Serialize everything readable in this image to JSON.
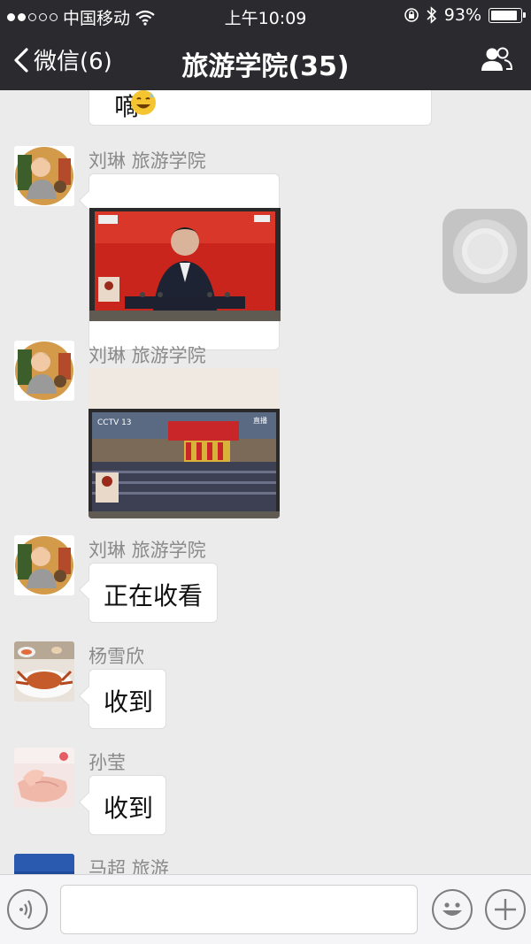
{
  "status_bar": {
    "carrier": "中国移动",
    "time": "上午10:09",
    "battery": "93%",
    "battery_level": 0.93
  },
  "nav": {
    "back_label": "微信(6)",
    "title": "旅游学院(35)"
  },
  "messages": [
    {
      "sender": "",
      "text": "嘀",
      "emoji": "grinning-sweat-emoji"
    },
    {
      "sender": "刘琳 旅游学院",
      "type": "image",
      "image": "tv-broadcast-speaker-photo"
    },
    {
      "sender": "刘琳 旅游学院",
      "type": "image",
      "image": "tv-broadcast-assembly-hall-photo",
      "tv_channel": "CCTV 13",
      "tv_live": "直播"
    },
    {
      "sender": "刘琳 旅游学院",
      "text": "正在收看"
    },
    {
      "sender": "杨雪欣",
      "text": "收到"
    },
    {
      "sender": "孙莹",
      "text": "收到"
    },
    {
      "sender": "马超 旅游",
      "text": ""
    }
  ],
  "input": {
    "placeholder": ""
  },
  "icons": {
    "back": "chevron-left-icon",
    "members": "people-icon",
    "voice": "voice-icon",
    "emoji": "smiley-icon",
    "more": "plus-icon"
  },
  "colors": {
    "header_bg": "#2b2b2f",
    "chat_bg": "#ebebeb",
    "bubble_bg": "#ffffff",
    "sender_text": "#8a8a8a"
  }
}
